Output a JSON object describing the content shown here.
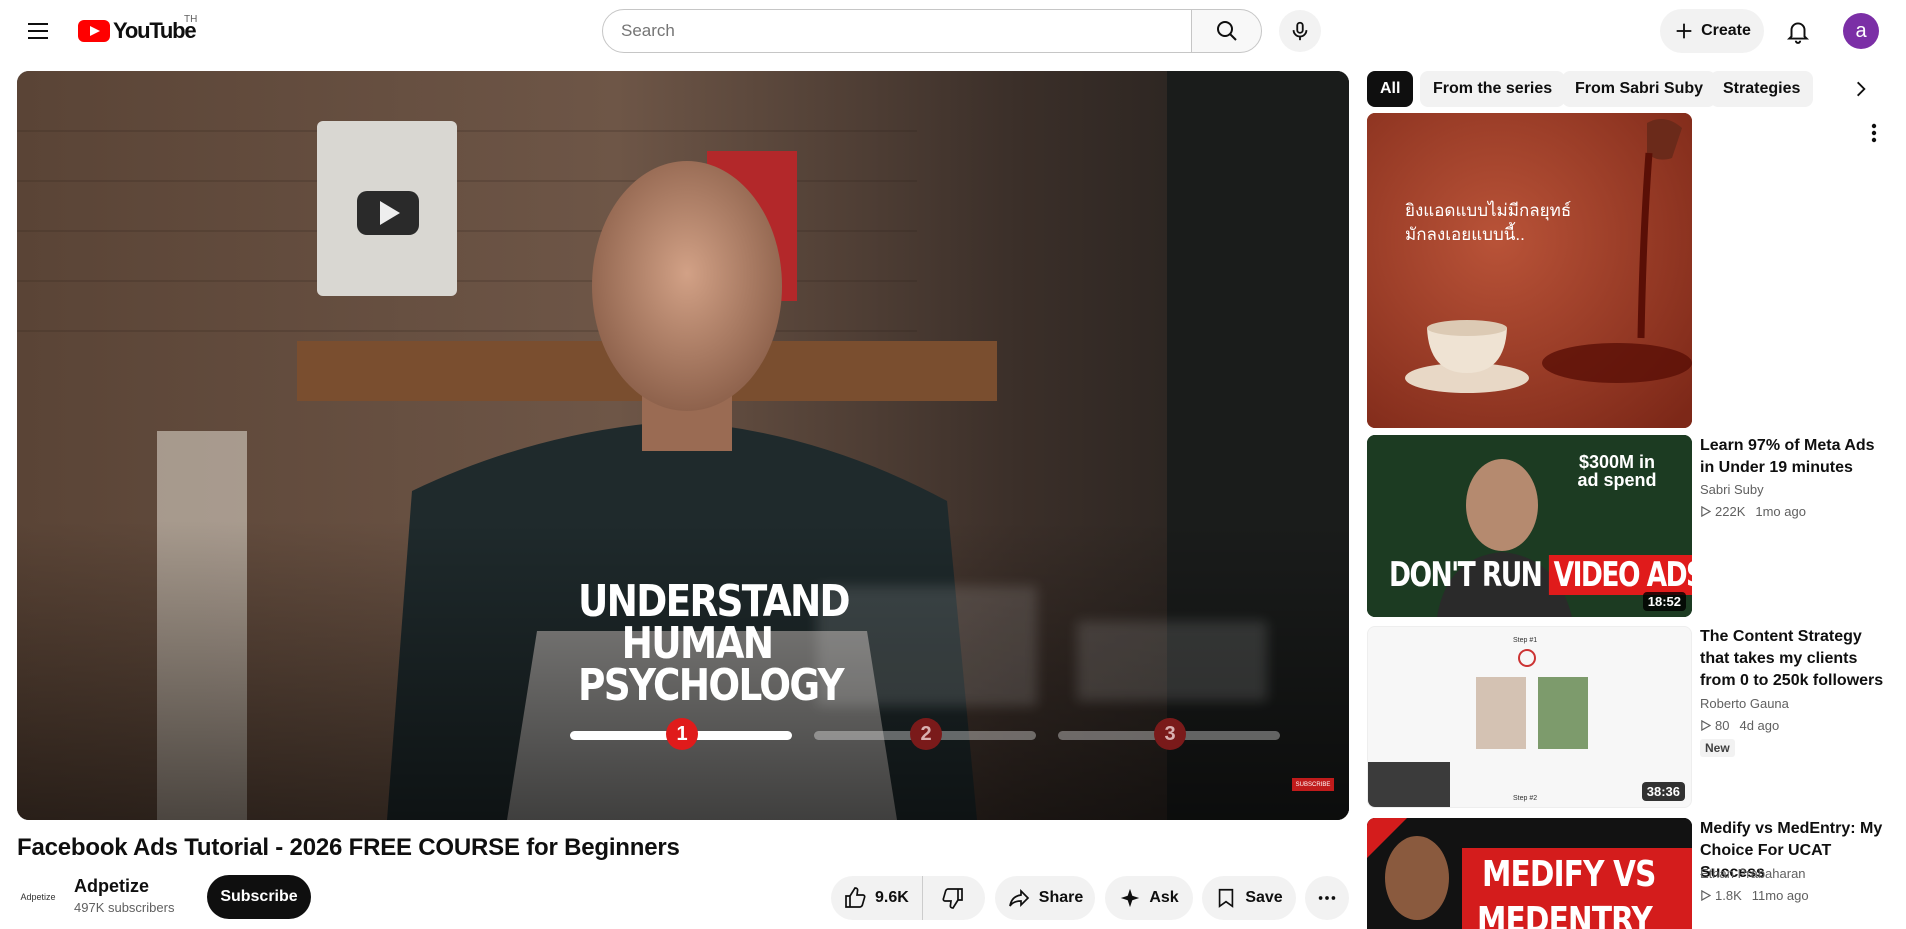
{
  "header": {
    "logo_text": "YouTube",
    "country_code": "TH",
    "search_placeholder": "Search",
    "create_label": "Create",
    "avatar_letter": "a"
  },
  "player": {
    "overlay_title_lines": [
      "UNDERSTAND",
      "HUMAN",
      "PSYCHOLOGY"
    ],
    "steps": [
      "1",
      "2",
      "3"
    ],
    "subscribe_watermark": "SUBSCRIBE"
  },
  "video": {
    "title": "Facebook Ads Tutorial - 2026 FREE COURSE for Beginners",
    "channel_logo_text": "Adpetize",
    "channel_name": "Adpetize",
    "subscribers": "497K subscribers",
    "subscribe_label": "Subscribe",
    "likes": "9.6K",
    "share_label": "Share",
    "ask_label": "Ask",
    "save_label": "Save"
  },
  "chips": [
    "All",
    "From the series",
    "From Sabri Suby",
    "Strategies"
  ],
  "recommendations": [
    {
      "thumb_text": "ยิงแอดแบบไม่มีกลยุทธ์ มักลงเอยแบบนี้..",
      "is_ad": true
    },
    {
      "title": "Learn 97% of Meta Ads in Under 19 minutes",
      "channel": "Sabri Suby",
      "views": "222K",
      "age": "1mo ago",
      "duration": "18:52",
      "thumb_top": "$300M in ad spend",
      "thumb_bottom_a": "DON'T RUN ",
      "thumb_bottom_b": "VIDEO ADS"
    },
    {
      "title": "The Content Strategy that takes my clients from 0 to 250k followers (full ...",
      "channel": "Roberto Gauna",
      "views": "80",
      "age": "4d ago",
      "badge": "New",
      "duration": "38:36",
      "thumb_top": "Step #1",
      "thumb_bottom": "Step #2"
    },
    {
      "title": "Medify vs MedEntry: My Choice For UCAT Success",
      "channel": "Ethan Prabaharan",
      "views": "1.8K",
      "age": "11mo ago",
      "thumb_line1": "MEDIFY VS",
      "thumb_line2": "MEDENTRY"
    }
  ],
  "colors": {
    "brand_red": "#ff0000",
    "avatar_bg": "#7b2fa6",
    "subscribe_bg": "#0f0f0f"
  }
}
